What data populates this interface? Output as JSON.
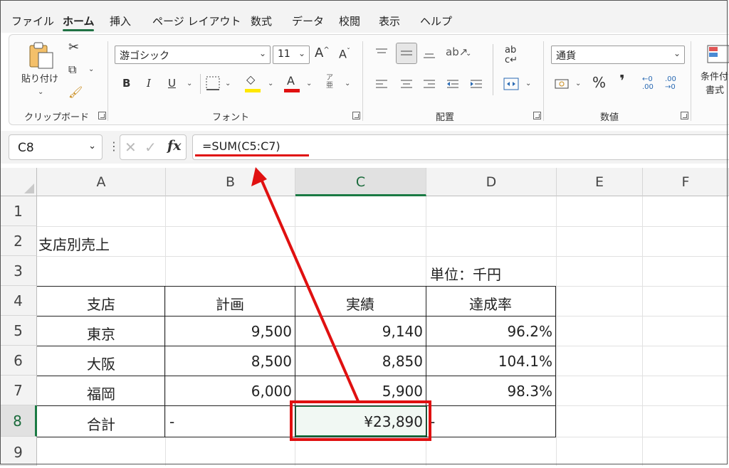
{
  "menu": {
    "tabs": [
      "ファイル",
      "ホーム",
      "挿入",
      "ページ レイアウト",
      "数式",
      "データ",
      "校閲",
      "表示",
      "ヘルプ"
    ],
    "active_tab": "ホーム"
  },
  "ribbon": {
    "clipboard": {
      "paste_label": "貼り付け",
      "group_label": "クリップボード"
    },
    "font": {
      "font_name": "游ゴシック",
      "font_size": "11",
      "bold": "B",
      "italic": "I",
      "underline": "U",
      "font_color_letter": "A",
      "grow_label": "A^",
      "shrink_label": "Aˇ",
      "phonetic": "ア亜",
      "group_label": "フォント",
      "highlight_color": "#ffe800",
      "font_color": "#e01010"
    },
    "alignment": {
      "group_label": "配置"
    },
    "number": {
      "format": "通貨",
      "percent": "%",
      "comma": "❜",
      "group_label": "数値"
    },
    "styles": {
      "cond_format_label_1": "条件付",
      "cond_format_label_2": "書式"
    }
  },
  "formula_bar": {
    "name_box": "C8",
    "fx": "fx",
    "formula": "=SUM(C5:C7)"
  },
  "sheet": {
    "columns": [
      "A",
      "B",
      "C",
      "D",
      "E",
      "F"
    ],
    "selected_column": "C",
    "rows": [
      "1",
      "2",
      "3",
      "4",
      "5",
      "6",
      "7",
      "8",
      "9"
    ],
    "selected_row": "8",
    "title": "支店別売上",
    "unit": "単位：千円",
    "headers": [
      "支店",
      "計画",
      "実績",
      "達成率"
    ],
    "data": [
      {
        "branch": "東京",
        "plan": "9,500",
        "actual": "9,140",
        "rate": "96.2%"
      },
      {
        "branch": "大阪",
        "plan": "8,500",
        "actual": "8,850",
        "rate": "104.1%"
      },
      {
        "branch": "福岡",
        "plan": "6,000",
        "actual": "5,900",
        "rate": "98.3%"
      }
    ],
    "total": {
      "label": "合計",
      "plan": "-",
      "actual": "¥23,890",
      "rate": "-"
    }
  },
  "colors": {
    "accent": "#1a7a43",
    "annotation": "#e01010"
  }
}
